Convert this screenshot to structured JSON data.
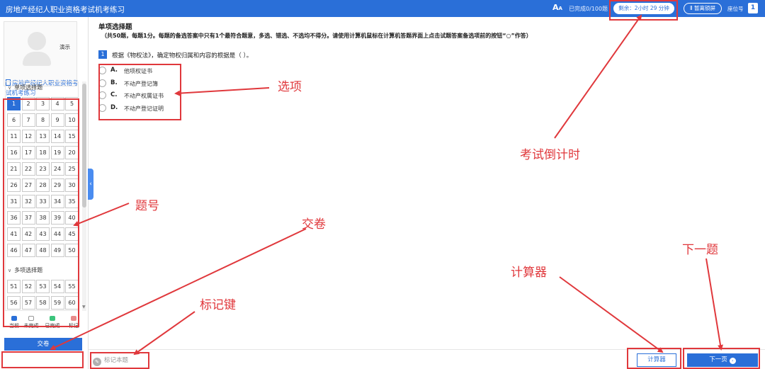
{
  "window": {
    "title": "房地产经纪人职业资格考试机考练习"
  },
  "header": {
    "font_icon_label": "A",
    "progress": "已完成0/100题",
    "countdown": "剩余：2小时 29 分钟",
    "pause_label": "Ⅱ 暂离锁屏",
    "seat_label": "座位号",
    "seat_number": "1"
  },
  "sidebar": {
    "user_name": "演示",
    "exam_name": "房地产经纪人职业资格考试机考练习",
    "sections": [
      {
        "title": "单项选择题",
        "questions": [
          "1",
          "2",
          "3",
          "4",
          "5",
          "6",
          "7",
          "8",
          "9",
          "10",
          "11",
          "12",
          "13",
          "14",
          "15",
          "16",
          "17",
          "18",
          "19",
          "20",
          "21",
          "22",
          "23",
          "24",
          "25",
          "26",
          "27",
          "28",
          "29",
          "30",
          "31",
          "32",
          "33",
          "34",
          "35",
          "36",
          "37",
          "38",
          "39",
          "40",
          "41",
          "42",
          "43",
          "44",
          "45",
          "46",
          "47",
          "48",
          "49",
          "50"
        ]
      },
      {
        "title": "多项选择题",
        "questions": [
          "51",
          "52",
          "53",
          "54",
          "55",
          "56",
          "57",
          "58",
          "59",
          "60"
        ]
      }
    ],
    "current_question": "1",
    "legend": [
      {
        "label": "当前",
        "color": "#2a6fd8"
      },
      {
        "label": "未完成",
        "color": "#ffffff"
      },
      {
        "label": "已完成",
        "color": "#3cc47c"
      },
      {
        "label": "标记",
        "color": "#e88a8a"
      }
    ],
    "submit_label": "交卷",
    "collapse_icon": "‹"
  },
  "question": {
    "section_heading": "单项选择题",
    "section_desc": "（共50题，每题1分。每题的备选答案中只有1个最符合题意，多选、错选、不选均不得分。请使用计算机鼠标在计算机答题界面上点击试题答案备选项前的按钮“○”作答）",
    "number": "1",
    "text": "根据《物权法》，确定物权归属和内容的根据是（      ）。",
    "options": [
      {
        "letter": "A.",
        "text": "他项权证书"
      },
      {
        "letter": "B.",
        "text": "不动产登记簿"
      },
      {
        "letter": "C.",
        "text": "不动产权属证书"
      },
      {
        "letter": "D.",
        "text": "不动产登记证明"
      }
    ]
  },
  "footer": {
    "mark_label": "标记本题",
    "calculator_label": "计算器",
    "next_label": "下一页"
  },
  "annotations": {
    "color": "#e0383c",
    "labels": {
      "options": "选项",
      "countdown": "考试倒计时",
      "question_number": "题号",
      "submit": "交卷",
      "mark": "标记键",
      "calculator": "计算器",
      "next": "下一题"
    }
  }
}
